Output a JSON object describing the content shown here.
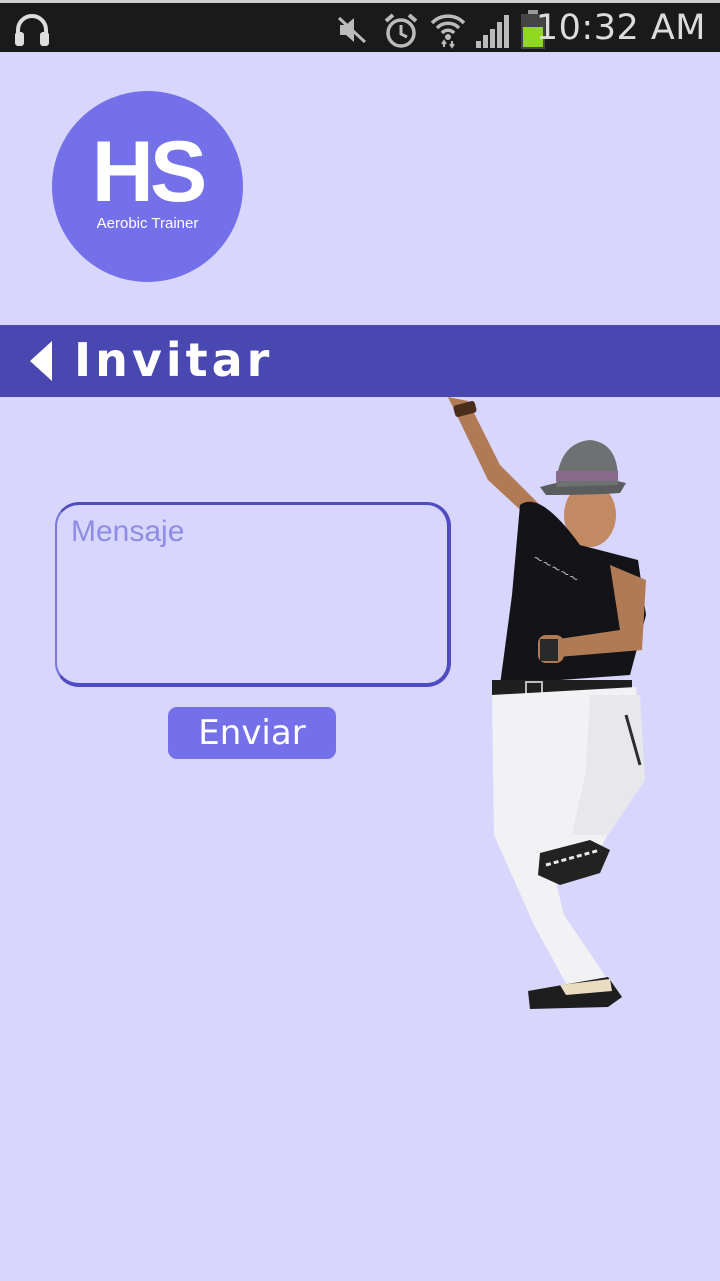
{
  "status_bar": {
    "time": "10:32 AM",
    "icons": [
      "headset-icon",
      "mute-icon",
      "alarm-icon",
      "wifi-icon",
      "signal-icon",
      "battery-icon"
    ]
  },
  "logo": {
    "initials": "HS",
    "subtitle": "Aerobic Trainer",
    "color": "#7370e9"
  },
  "header": {
    "title": "Invitar",
    "back_icon": "back-arrow-icon",
    "color": "#4948b0"
  },
  "form": {
    "message_placeholder": "Mensaje",
    "message_value": "",
    "send_label": "Enviar"
  },
  "colors": {
    "background": "#d8d6fd",
    "accent": "#7370e9",
    "header": "#4948b0"
  }
}
